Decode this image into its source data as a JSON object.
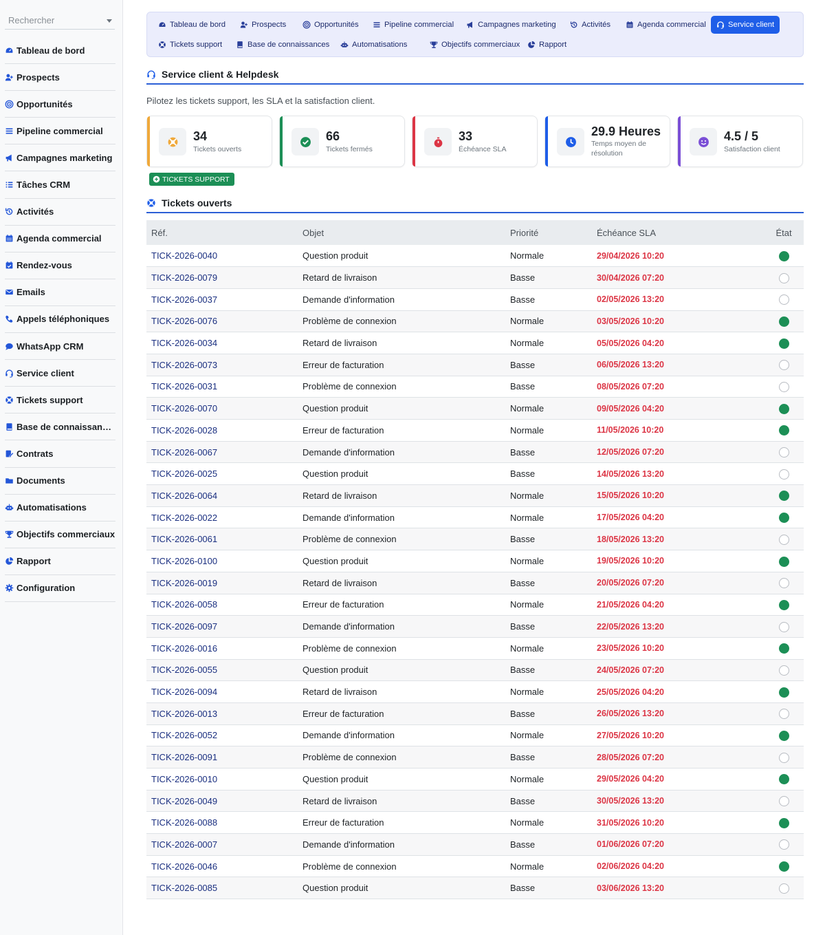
{
  "sidebar": {
    "search_placeholder": "Rechercher",
    "items": [
      {
        "label": "Tableau de bord",
        "icon": "dashboard-icon"
      },
      {
        "label": "Prospects",
        "icon": "user-plus-icon"
      },
      {
        "label": "Opportunités",
        "icon": "target-icon"
      },
      {
        "label": "Pipeline commercial",
        "icon": "bars-icon"
      },
      {
        "label": "Campagnes marketing",
        "icon": "megaphone-icon"
      },
      {
        "label": "Tâches CRM",
        "icon": "tasks-icon"
      },
      {
        "label": "Activités",
        "icon": "history-icon"
      },
      {
        "label": "Agenda commercial",
        "icon": "calendar-icon"
      },
      {
        "label": "Rendez-vous",
        "icon": "calendar-check-icon"
      },
      {
        "label": "Emails",
        "icon": "envelope-icon"
      },
      {
        "label": "Appels téléphoniques",
        "icon": "phone-icon"
      },
      {
        "label": "WhatsApp CRM",
        "icon": "chat-icon"
      },
      {
        "label": "Service client",
        "icon": "headset-icon"
      },
      {
        "label": "Tickets support",
        "icon": "lifebuoy-icon"
      },
      {
        "label": "Base de connaissances",
        "icon": "book-icon"
      },
      {
        "label": "Contrats",
        "icon": "contract-icon"
      },
      {
        "label": "Documents",
        "icon": "folder-icon"
      },
      {
        "label": "Automatisations",
        "icon": "robot-icon"
      },
      {
        "label": "Objectifs commerciaux",
        "icon": "trophy-icon"
      },
      {
        "label": "Rapport",
        "icon": "pie-chart-icon"
      },
      {
        "label": "Configuration",
        "icon": "gear-icon"
      }
    ]
  },
  "topnav": {
    "items": [
      {
        "label": "Tableau de bord",
        "icon": "dashboard-icon",
        "active": false
      },
      {
        "label": "Prospects",
        "icon": "user-plus-icon",
        "active": false
      },
      {
        "label": "Opportunités",
        "icon": "target-icon",
        "active": false
      },
      {
        "label": "Pipeline commercial",
        "icon": "bars-icon",
        "active": false
      },
      {
        "label": "Campagnes marketing",
        "icon": "megaphone-icon",
        "active": false
      },
      {
        "label": "Activités",
        "icon": "history-icon",
        "active": false
      },
      {
        "label": "Agenda commercial",
        "icon": "calendar-icon",
        "active": false
      },
      {
        "label": "Service client",
        "icon": "headset-icon",
        "active": true
      },
      {
        "label": "Tickets support",
        "icon": "lifebuoy-icon",
        "active": false
      },
      {
        "label": "Base de connaissances",
        "icon": "book-icon",
        "active": false
      },
      {
        "label": "Automatisations",
        "icon": "robot-icon",
        "active": false
      },
      {
        "label": "Objectifs commerciaux",
        "icon": "trophy-icon",
        "active": false
      },
      {
        "label": "Rapport",
        "icon": "pie-chart-icon",
        "active": false
      }
    ]
  },
  "page": {
    "title": "Service client & Helpdesk",
    "subtitle": "Pilotez les tickets support, les SLA et la satisfaction client."
  },
  "stats": [
    {
      "value": "34",
      "label": "Tickets ouverts",
      "color": "#f0a93b",
      "icon": "lifebuoy-icon"
    },
    {
      "value": "66",
      "label": "Tickets fermés",
      "color": "#1c8f56",
      "icon": "check-circle-icon"
    },
    {
      "value": "33",
      "label": "Échéance SLA",
      "color": "#dc3545",
      "icon": "stopwatch-icon"
    },
    {
      "value": "29.9 Heures",
      "label": "Temps moyen de résolution",
      "color": "#1f5ee8",
      "icon": "clock-icon"
    },
    {
      "value": "4.5 / 5",
      "label": "Satisfaction client",
      "color": "#7b4fd6",
      "icon": "smile-icon"
    }
  ],
  "support_button": "TICKETS SUPPORT",
  "tickets": {
    "title": "Tickets ouverts",
    "columns": [
      "Réf.",
      "Objet",
      "Priorité",
      "Échéance SLA",
      "État"
    ],
    "rows": [
      {
        "ref": "TICK-2026-0040",
        "objet": "Question produit",
        "priorite": "Normale",
        "sla": "29/04/2026 10:20",
        "etat": true
      },
      {
        "ref": "TICK-2026-0079",
        "objet": "Retard de livraison",
        "priorite": "Basse",
        "sla": "30/04/2026 07:20",
        "etat": false
      },
      {
        "ref": "TICK-2026-0037",
        "objet": "Demande d'information",
        "priorite": "Basse",
        "sla": "02/05/2026 13:20",
        "etat": false
      },
      {
        "ref": "TICK-2026-0076",
        "objet": "Problème de connexion",
        "priorite": "Normale",
        "sla": "03/05/2026 10:20",
        "etat": true
      },
      {
        "ref": "TICK-2026-0034",
        "objet": "Retard de livraison",
        "priorite": "Normale",
        "sla": "05/05/2026 04:20",
        "etat": true
      },
      {
        "ref": "TICK-2026-0073",
        "objet": "Erreur de facturation",
        "priorite": "Basse",
        "sla": "06/05/2026 13:20",
        "etat": false
      },
      {
        "ref": "TICK-2026-0031",
        "objet": "Problème de connexion",
        "priorite": "Basse",
        "sla": "08/05/2026 07:20",
        "etat": false
      },
      {
        "ref": "TICK-2026-0070",
        "objet": "Question produit",
        "priorite": "Normale",
        "sla": "09/05/2026 04:20",
        "etat": true
      },
      {
        "ref": "TICK-2026-0028",
        "objet": "Erreur de facturation",
        "priorite": "Normale",
        "sla": "11/05/2026 10:20",
        "etat": true
      },
      {
        "ref": "TICK-2026-0067",
        "objet": "Demande d'information",
        "priorite": "Basse",
        "sla": "12/05/2026 07:20",
        "etat": false
      },
      {
        "ref": "TICK-2026-0025",
        "objet": "Question produit",
        "priorite": "Basse",
        "sla": "14/05/2026 13:20",
        "etat": false
      },
      {
        "ref": "TICK-2026-0064",
        "objet": "Retard de livraison",
        "priorite": "Normale",
        "sla": "15/05/2026 10:20",
        "etat": true
      },
      {
        "ref": "TICK-2026-0022",
        "objet": "Demande d'information",
        "priorite": "Normale",
        "sla": "17/05/2026 04:20",
        "etat": true
      },
      {
        "ref": "TICK-2026-0061",
        "objet": "Problème de connexion",
        "priorite": "Basse",
        "sla": "18/05/2026 13:20",
        "etat": false
      },
      {
        "ref": "TICK-2026-0100",
        "objet": "Question produit",
        "priorite": "Normale",
        "sla": "19/05/2026 10:20",
        "etat": true
      },
      {
        "ref": "TICK-2026-0019",
        "objet": "Retard de livraison",
        "priorite": "Basse",
        "sla": "20/05/2026 07:20",
        "etat": false
      },
      {
        "ref": "TICK-2026-0058",
        "objet": "Erreur de facturation",
        "priorite": "Normale",
        "sla": "21/05/2026 04:20",
        "etat": true
      },
      {
        "ref": "TICK-2026-0097",
        "objet": "Demande d'information",
        "priorite": "Basse",
        "sla": "22/05/2026 13:20",
        "etat": false
      },
      {
        "ref": "TICK-2026-0016",
        "objet": "Problème de connexion",
        "priorite": "Normale",
        "sla": "23/05/2026 10:20",
        "etat": true
      },
      {
        "ref": "TICK-2026-0055",
        "objet": "Question produit",
        "priorite": "Basse",
        "sla": "24/05/2026 07:20",
        "etat": false
      },
      {
        "ref": "TICK-2026-0094",
        "objet": "Retard de livraison",
        "priorite": "Normale",
        "sla": "25/05/2026 04:20",
        "etat": true
      },
      {
        "ref": "TICK-2026-0013",
        "objet": "Erreur de facturation",
        "priorite": "Basse",
        "sla": "26/05/2026 13:20",
        "etat": false
      },
      {
        "ref": "TICK-2026-0052",
        "objet": "Demande d'information",
        "priorite": "Normale",
        "sla": "27/05/2026 10:20",
        "etat": true
      },
      {
        "ref": "TICK-2026-0091",
        "objet": "Problème de connexion",
        "priorite": "Basse",
        "sla": "28/05/2026 07:20",
        "etat": false
      },
      {
        "ref": "TICK-2026-0010",
        "objet": "Question produit",
        "priorite": "Normale",
        "sla": "29/05/2026 04:20",
        "etat": true
      },
      {
        "ref": "TICK-2026-0049",
        "objet": "Retard de livraison",
        "priorite": "Basse",
        "sla": "30/05/2026 13:20",
        "etat": false
      },
      {
        "ref": "TICK-2026-0088",
        "objet": "Erreur de facturation",
        "priorite": "Normale",
        "sla": "31/05/2026 10:20",
        "etat": true
      },
      {
        "ref": "TICK-2026-0007",
        "objet": "Demande d'information",
        "priorite": "Basse",
        "sla": "01/06/2026 07:20",
        "etat": false
      },
      {
        "ref": "TICK-2026-0046",
        "objet": "Problème de connexion",
        "priorite": "Normale",
        "sla": "02/06/2026 04:20",
        "etat": true
      },
      {
        "ref": "TICK-2026-0085",
        "objet": "Question produit",
        "priorite": "Basse",
        "sla": "03/06/2026 13:20",
        "etat": false
      }
    ]
  },
  "colors": {
    "accent": "#1f5ee8",
    "sla_text": "#dc3545",
    "state_on": "#1c8f56",
    "nav_bg": "#ebedfc"
  }
}
